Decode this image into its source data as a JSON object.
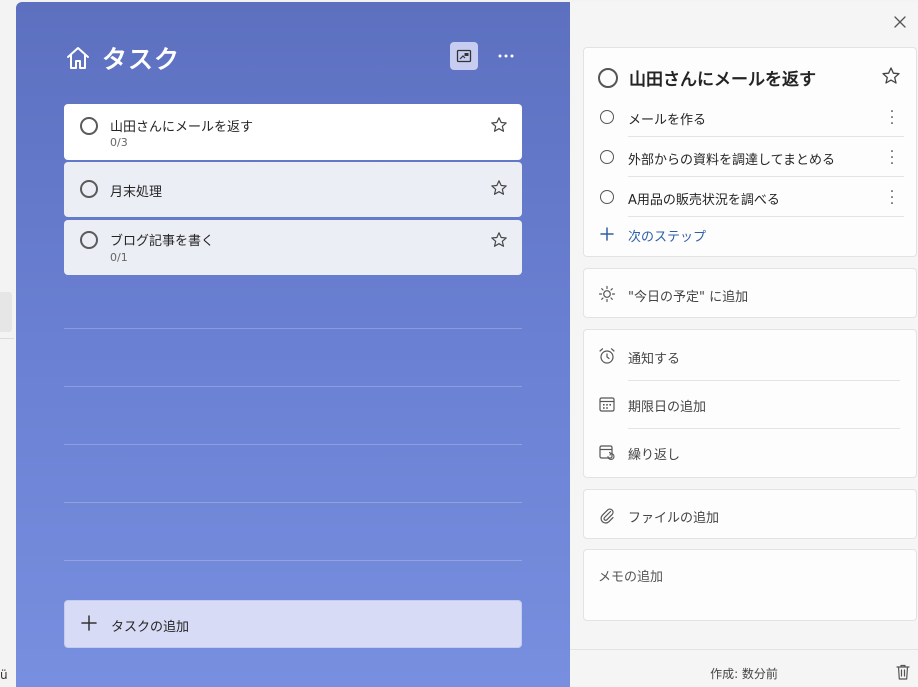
{
  "sidebar_edge": {
    "glyph": "ü"
  },
  "list": {
    "title": "タスク",
    "tasks": [
      {
        "name": "山田さんにメールを返す",
        "progress": "0/3",
        "selected": true
      },
      {
        "name": "月末処理",
        "progress": "",
        "selected": false
      },
      {
        "name": "ブログ記事を書く",
        "progress": "0/1",
        "selected": false
      }
    ],
    "add_task_label": "タスクの追加"
  },
  "detail": {
    "title": "山田さんにメールを返す",
    "steps": [
      {
        "label": "メールを作る"
      },
      {
        "label": "外部からの資料を調達してまとめる"
      },
      {
        "label": "A用品の販売状況を調べる"
      }
    ],
    "next_step_label": "次のステップ",
    "my_day_label": "\"今日の予定\" に追加",
    "remind_label": "通知する",
    "due_label": "期限日の追加",
    "repeat_label": "繰り返し",
    "file_label": "ファイルの追加",
    "memo_placeholder": "メモの追加",
    "created_label": "作成: 数分前"
  },
  "colors": {
    "accent": "#2f5fa8",
    "list_bg_top": "#5d70c0",
    "list_bg_bottom": "#788fe0"
  },
  "icons": {
    "home": "home-icon",
    "view": "picture-view-icon",
    "more": "more-icon",
    "star": "star-icon",
    "close": "close-icon",
    "sun": "sun-icon",
    "alarm": "alarm-icon",
    "calendar": "calendar-icon",
    "repeat": "repeat-calendar-icon",
    "attach": "paperclip-icon",
    "trash": "trash-icon",
    "plus": "plus-icon"
  }
}
